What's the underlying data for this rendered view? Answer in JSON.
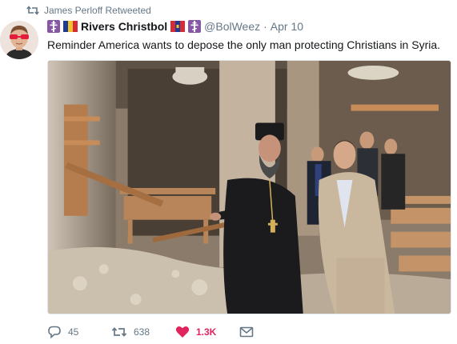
{
  "retweet_header": {
    "text": "James Perloff Retweeted"
  },
  "tweet": {
    "display_name": "Rivers Christbol",
    "handle": "@BolWeez",
    "separator": "·",
    "date": "Apr 10",
    "text": "Reminder America wants to depose the only man protecting Christians in Syria."
  },
  "actions": {
    "replies": "45",
    "retweets": "638",
    "likes": "1.3K"
  },
  "colors": {
    "text_primary": "#14171a",
    "text_secondary": "#657786",
    "like_active": "#e0245e"
  },
  "icons": [
    "retweet-icon",
    "orthodox-cross-icon",
    "flag-icon",
    "reply-icon",
    "heart-icon",
    "direct-message-icon"
  ]
}
